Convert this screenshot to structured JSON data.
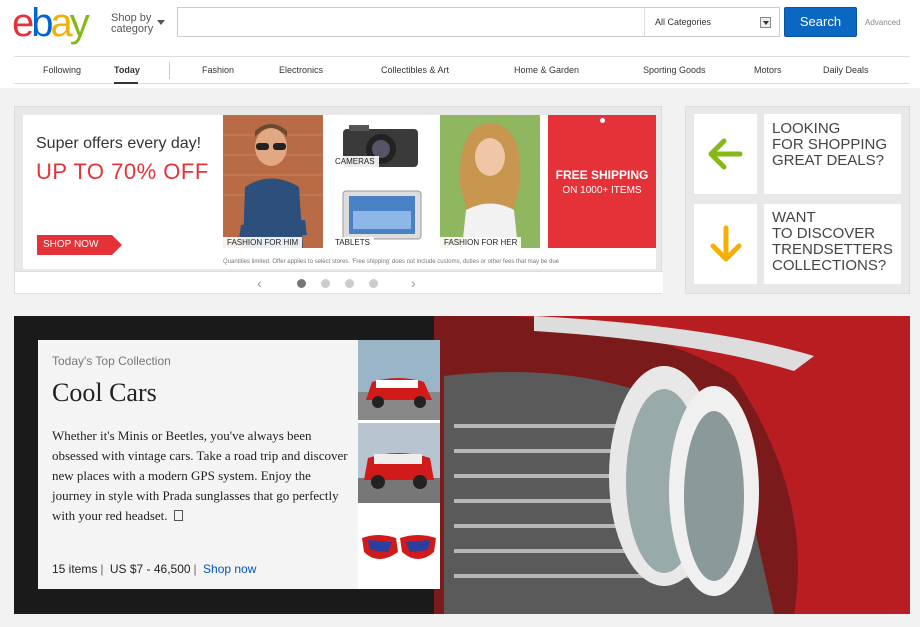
{
  "header": {
    "logo": {
      "e": "e",
      "b": "b",
      "a": "a",
      "y": "y"
    },
    "shop_by": {
      "line1": "Shop by",
      "line2": "category"
    },
    "search": {
      "placeholder": "",
      "category": "All Categories",
      "button": "Search",
      "advanced": "Advanced"
    }
  },
  "nav": {
    "items": [
      "Following",
      "Today",
      "Fashion",
      "Electronics",
      "Collectibles & Art",
      "Home & Garden",
      "Sporting Goods",
      "Motors",
      "Daily Deals"
    ],
    "active": "Today"
  },
  "promo": {
    "tagline": "Super offers every day!",
    "headline": "UP TO 70% OFF",
    "cta": "SHOP NOW",
    "tiles": [
      "FASHION FOR HIM",
      "CAMERAS",
      "TABLETS",
      "FASHION FOR HER"
    ],
    "free_shipping": {
      "line1": "FREE SHIPPING",
      "line2": "ON 1000+ ITEMS"
    },
    "disclaimer": "Quantities limited. Offer applies to select stores. 'Free shipping' does not include customs, duties or other fees that may be due",
    "pagination": {
      "total": 4,
      "current": 1
    }
  },
  "side": {
    "box1": "LOOKING\nFOR SHOPPING\nGREAT DEALS?",
    "box2": "WANT\nTO DISCOVER\nTRENDSETTERS\nCOLLECTIONS?",
    "colors": {
      "green": "#86b817",
      "orange": "#f5af02"
    }
  },
  "collection": {
    "kicker": "Today's Top Collection",
    "title": "Cool Cars",
    "description": "Whether it's Minis or Beetles, you've always been obsessed with vintage cars. Take a road trip and discover new places with a modern GPS system. Enjoy the journey in style with Prada sunglasses that go perfectly with your red headset.",
    "items": "15 items",
    "price": "US $7 - 46,500",
    "link": "Shop now"
  },
  "colors": {
    "accent_red": "#e53238",
    "search_blue": "#0a67c2",
    "link_blue": "#0654ba"
  }
}
